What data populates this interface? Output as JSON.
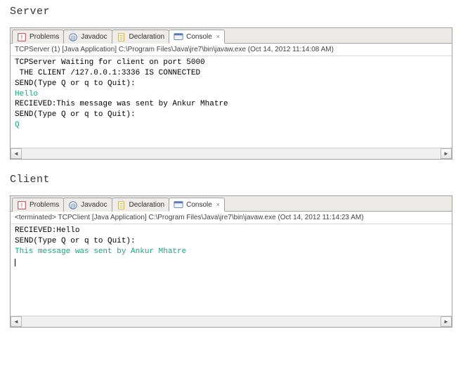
{
  "server": {
    "title": "Server",
    "tabs": [
      {
        "label": "Problems"
      },
      {
        "label": "Javadoc"
      },
      {
        "label": "Declaration"
      },
      {
        "label": "Console"
      }
    ],
    "run_info": "TCPServer (1) [Java Application] C:\\Program Files\\Java\\jre7\\bin\\javaw.exe (Oct 14, 2012 11:14:08 AM)",
    "lines": {
      "l0": "TCPServer Waiting for client on port 5000",
      "l1": " THE CLIENT /127.0.0.1:3336 IS CONNECTED",
      "l2": "SEND(Type Q or q to Quit):",
      "l3": "Hello",
      "l4": "RECIEVED:This message was sent by Ankur Mhatre",
      "l5": "SEND(Type Q or q to Quit):",
      "l6": "Q"
    }
  },
  "client": {
    "title": "Client",
    "tabs": [
      {
        "label": "Problems"
      },
      {
        "label": "Javadoc"
      },
      {
        "label": "Declaration"
      },
      {
        "label": "Console"
      }
    ],
    "run_info": "<terminated> TCPClient [Java Application] C:\\Program Files\\Java\\jre7\\bin\\javaw.exe (Oct 14, 2012 11:14:23 AM)",
    "lines": {
      "l0": "RECIEVED:Hello",
      "l1": "SEND(Type Q or q to Quit):",
      "l2": "This message was sent by Ankur Mhatre"
    }
  },
  "icons": {
    "close_label": "×"
  }
}
